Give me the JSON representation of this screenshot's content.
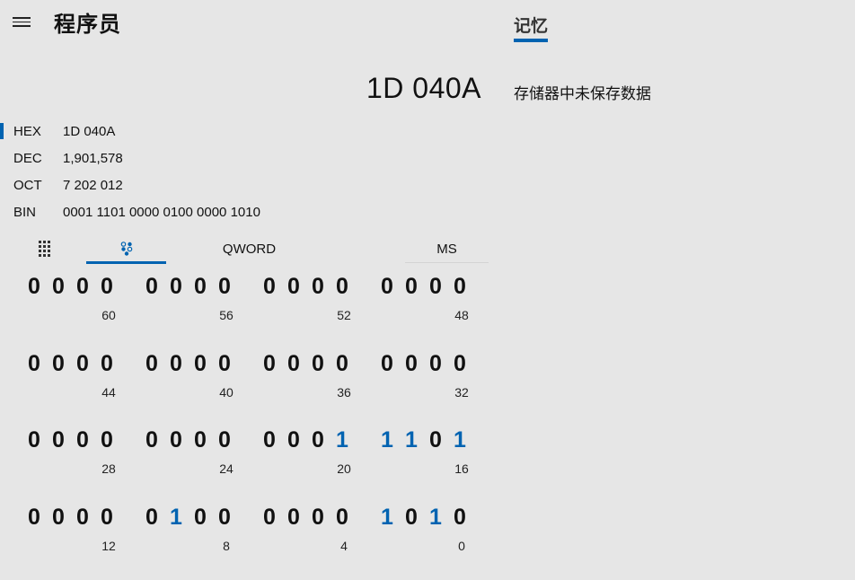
{
  "header": {
    "title": "程序员",
    "menu_icon": "hamburger-icon"
  },
  "memory": {
    "tab_label": "记忆",
    "empty_message": "存储器中未保存数据"
  },
  "display": {
    "value": "1D 040A"
  },
  "radix": [
    {
      "label": "HEX",
      "value": "1D 040A",
      "active": true
    },
    {
      "label": "DEC",
      "value": "1,901,578",
      "active": false
    },
    {
      "label": "OCT",
      "value": "7 202 012",
      "active": false
    },
    {
      "label": "BIN",
      "value": "0001 1101 0000 0100 0000 1010",
      "active": false
    }
  ],
  "toolbar": {
    "keypad_icon": "full-keypad-icon",
    "bitflip_icon": "bit-toggling-keypad-icon",
    "word_size": "QWORD",
    "ms_label": "MS"
  },
  "bit_rows": [
    {
      "groups": [
        {
          "bits": [
            "0",
            "0",
            "0",
            "0"
          ],
          "pos": "60"
        },
        {
          "bits": [
            "0",
            "0",
            "0",
            "0"
          ],
          "pos": "56"
        },
        {
          "bits": [
            "0",
            "0",
            "0",
            "0"
          ],
          "pos": "52"
        },
        {
          "bits": [
            "0",
            "0",
            "0",
            "0"
          ],
          "pos": "48"
        }
      ]
    },
    {
      "groups": [
        {
          "bits": [
            "0",
            "0",
            "0",
            "0"
          ],
          "pos": "44"
        },
        {
          "bits": [
            "0",
            "0",
            "0",
            "0"
          ],
          "pos": "40"
        },
        {
          "bits": [
            "0",
            "0",
            "0",
            "0"
          ],
          "pos": "36"
        },
        {
          "bits": [
            "0",
            "0",
            "0",
            "0"
          ],
          "pos": "32"
        }
      ]
    },
    {
      "groups": [
        {
          "bits": [
            "0",
            "0",
            "0",
            "0"
          ],
          "pos": "28"
        },
        {
          "bits": [
            "0",
            "0",
            "0",
            "0"
          ],
          "pos": "24"
        },
        {
          "bits": [
            "0",
            "0",
            "0",
            "1"
          ],
          "pos": "20"
        },
        {
          "bits": [
            "1",
            "1",
            "0",
            "1"
          ],
          "pos": "16"
        }
      ]
    },
    {
      "groups": [
        {
          "bits": [
            "0",
            "0",
            "0",
            "0"
          ],
          "pos": "12"
        },
        {
          "bits": [
            "0",
            "1",
            "0",
            "0"
          ],
          "pos": "8"
        },
        {
          "bits": [
            "0",
            "0",
            "0",
            "0"
          ],
          "pos": "4"
        },
        {
          "bits": [
            "1",
            "0",
            "1",
            "0"
          ],
          "pos": "0"
        }
      ]
    }
  ],
  "colors": {
    "accent": "#0063b1",
    "background": "#e6e6e6"
  }
}
